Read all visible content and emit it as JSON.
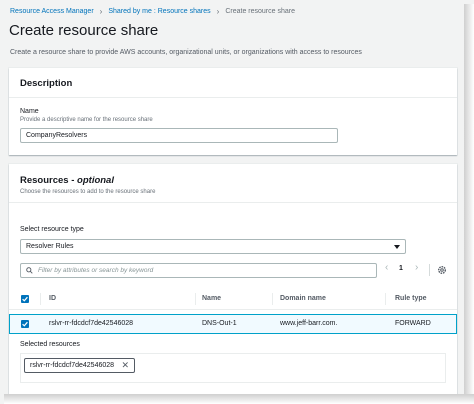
{
  "breadcrumb": {
    "items": [
      "Resource Access Manager",
      "Shared by me : Resource shares"
    ],
    "current": "Create resource share"
  },
  "page": {
    "title": "Create resource share",
    "subtitle": "Create a resource share to provide AWS accounts, organizational units, or organizations with access to resources"
  },
  "description_section": {
    "title": "Description",
    "name_label": "Name",
    "name_hint": "Provide a descriptive name for the resource share",
    "name_value": "CompanyResolvers"
  },
  "resources_section": {
    "title": "Resources",
    "title_suffix": "optional",
    "description": "Choose the resources to add to the resource share",
    "resource_type_label": "Select resource type",
    "resource_type_value": "Resolver Rules",
    "filter_placeholder": "Filter by attributes or search by keyword",
    "page_number": "1",
    "columns": [
      "ID",
      "Name",
      "Domain name",
      "Rule type"
    ],
    "rows": [
      {
        "id": "rslvr-rr-fdcdcf7de42546028",
        "name": "DNS-Out-1",
        "domain": "www.jeff-barr.com.",
        "rule_type": "FORWARD",
        "selected": true
      }
    ],
    "selected_label": "Selected resources",
    "selected_tokens": [
      "rslvr-rr-fdcdcf7de42546028"
    ]
  },
  "colors": {
    "link": "#0073bb",
    "accent": "#0073bb",
    "selected_row_bg": "#f1faff",
    "selected_row_border": "#00a1c9"
  },
  "icons": [
    "search-icon",
    "chevron-left-icon",
    "chevron-right-icon",
    "gear-icon",
    "checkbox-checked-icon",
    "caret-down-icon",
    "close-icon"
  ]
}
